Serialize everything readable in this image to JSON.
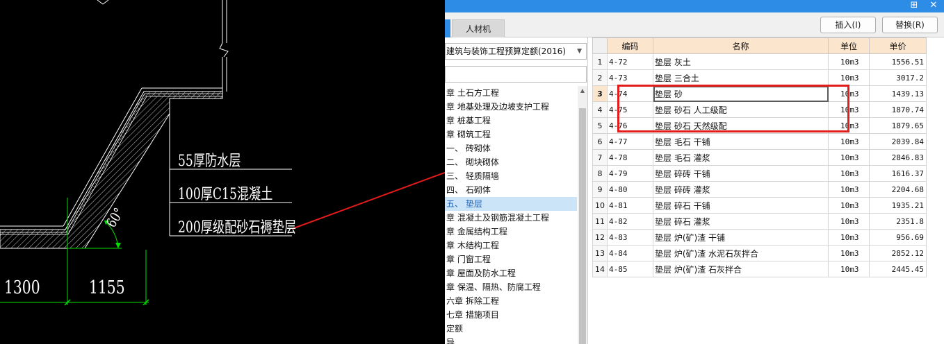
{
  "cad": {
    "layers": [
      "55厚防水层",
      "100厚C15混凝土",
      "200厚级配砂石褥垫层"
    ],
    "angle": "60°",
    "dimensions": [
      "1300",
      "1155"
    ]
  },
  "dialog": {
    "tabs": [
      {
        "label": "人材机"
      }
    ],
    "buttons": {
      "insert": "插入(I)",
      "replace": "替换(R)"
    },
    "title_controls": {
      "pin": "⊞",
      "close": "✕"
    },
    "library_select": {
      "value": "建筑与装饰工程预算定额(2016)"
    },
    "search": {
      "placeholder": ""
    },
    "tree": [
      {
        "label": "一章 土石方工程",
        "visible": "一章 土石方工程"
      },
      {
        "label": "二章 地基处理及边坡支护工程"
      },
      {
        "label": "三章 桩基工程"
      },
      {
        "label": "四章 砌筑工程"
      },
      {
        "label": "一、 砖砌体"
      },
      {
        "label": "二、 砌块砌体"
      },
      {
        "label": "三、 轻质隔墙"
      },
      {
        "label": "四、 石砌体"
      },
      {
        "label": "五、 垫层"
      },
      {
        "label": "五章 混凝土及钢筋混凝土工程"
      },
      {
        "label": "六章 金属结构工程"
      },
      {
        "label": "七章 木结构工程"
      },
      {
        "label": "八章 门窗工程"
      },
      {
        "label": "九章 屋面及防水工程"
      },
      {
        "label": "十章 保温、隔热、防腐工程"
      },
      {
        "label": "十六章 拆除工程"
      },
      {
        "label": "十七章 措施项目"
      },
      {
        "label": "补充定额"
      },
      {
        "label": "导"
      }
    ],
    "tree_display": [
      "章 土石方工程",
      "章 地基处理及边坡支护工程",
      "章 桩基工程",
      "章 砌筑工程",
      "一、 砖砌体",
      "二、 砌块砌体",
      "三、 轻质隔墙",
      "四、 石砌体",
      "五、 垫层",
      "章 混凝土及钢筋混凝土工程",
      "章 金属结构工程",
      "章 木结构工程",
      "章 门窗工程",
      "章 屋面及防水工程",
      "章 保温、隔热、防腐工程",
      "六章 拆除工程",
      "七章 措施项目",
      "定额",
      "导"
    ],
    "grid": {
      "headers": [
        "编码",
        "名称",
        "单位",
        "单价"
      ],
      "rows": [
        {
          "no": "1",
          "code": "4-72",
          "name": "垫层 灰土",
          "unit": "10m3",
          "price": "1556.51"
        },
        {
          "no": "2",
          "code": "4-73",
          "name": "垫层 三合土",
          "unit": "10m3",
          "price": "3017.2"
        },
        {
          "no": "3",
          "code": "4-74",
          "name": "垫层 砂",
          "unit": "10m3",
          "price": "1439.13"
        },
        {
          "no": "4",
          "code": "4-75",
          "name": "垫层 砂石 人工级配",
          "unit": "10m3",
          "price": "1870.74"
        },
        {
          "no": "5",
          "code": "4-76",
          "name": "垫层 砂石 天然级配",
          "unit": "10m3",
          "price": "1879.65"
        },
        {
          "no": "6",
          "code": "4-77",
          "name": "垫层 毛石 干铺",
          "unit": "10m3",
          "price": "2039.84"
        },
        {
          "no": "7",
          "code": "4-78",
          "name": "垫层 毛石 灌浆",
          "unit": "10m3",
          "price": "2846.83"
        },
        {
          "no": "8",
          "code": "4-79",
          "name": "垫层 碎砖 干铺",
          "unit": "10m3",
          "price": "1616.37"
        },
        {
          "no": "9",
          "code": "4-80",
          "name": "垫层 碎砖 灌浆",
          "unit": "10m3",
          "price": "2204.68"
        },
        {
          "no": "10",
          "code": "4-81",
          "name": "垫层 碎石 干铺",
          "unit": "10m3",
          "price": "1935.21"
        },
        {
          "no": "11",
          "code": "4-82",
          "name": "垫层 碎石 灌浆",
          "unit": "10m3",
          "price": "2351.8"
        },
        {
          "no": "12",
          "code": "4-83",
          "name": "垫层 炉(矿)渣 干铺",
          "unit": "10m3",
          "price": "956.69"
        },
        {
          "no": "13",
          "code": "4-84",
          "name": "垫层 炉(矿)渣 水泥石灰拌合",
          "unit": "10m3",
          "price": "2852.12"
        },
        {
          "no": "14",
          "code": "4-85",
          "name": "垫层 炉(矿)渣 石灰拌合",
          "unit": "10m3",
          "price": "2445.45"
        }
      ]
    }
  },
  "colors": {
    "titlebar": "#2d8ce6",
    "header": "#fbe5cd",
    "annotation": "#e31b1b",
    "selection": "#cce4f7",
    "dimension": "#00e000"
  }
}
